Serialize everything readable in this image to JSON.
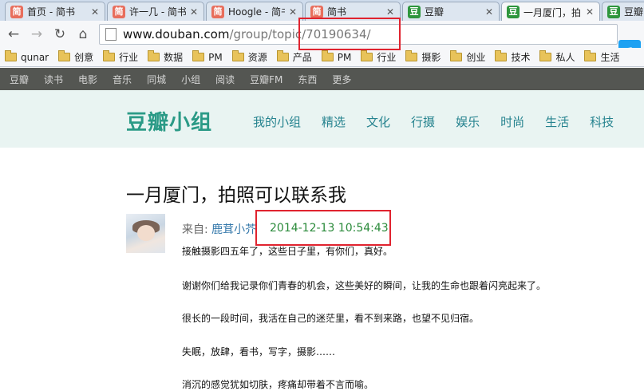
{
  "tabs": [
    {
      "icon": "jianshu-icon",
      "glyph": "简",
      "title": "首页 - 简书"
    },
    {
      "icon": "jianshu-icon",
      "glyph": "简",
      "title": "许一几 - 简书"
    },
    {
      "icon": "jianshu-icon",
      "glyph": "简",
      "title": "Hoogle - 简书"
    },
    {
      "icon": "jianshu-icon",
      "glyph": "简",
      "title": "简书"
    },
    {
      "icon": "douban-icon",
      "glyph": "豆",
      "title": "豆瓣"
    },
    {
      "icon": "douban-icon",
      "glyph": "豆",
      "title": "一月厦门，拍"
    },
    {
      "icon": "douban-icon",
      "glyph": "豆",
      "title": "豆瓣"
    }
  ],
  "toolbar": {
    "url_host": "www.douban.com",
    "url_path": "/group/topic/70190634/"
  },
  "bookmarks": [
    "qunar",
    "创意",
    "行业",
    "数据",
    "PM",
    "资源",
    "产品",
    "PM",
    "行业",
    "摄影",
    "创业",
    "技术",
    "私人",
    "生活"
  ],
  "global_nav": [
    "豆瓣",
    "读书",
    "电影",
    "音乐",
    "同城",
    "小组",
    "阅读",
    "豆瓣FM",
    "东西",
    "更多"
  ],
  "group_header": {
    "logo": "豆瓣小组",
    "menu": [
      "我的小组",
      "精选",
      "文化",
      "行摄",
      "娱乐",
      "时尚",
      "生活",
      "科技"
    ]
  },
  "topic": {
    "title": "一月厦门，拍照可以联系我",
    "from_label": "来自: ",
    "author": "鹿茸小芥",
    "timestamp": "2014-12-13 10:54:43",
    "paragraphs": [
      "接触摄影四五年了，这些日子里，有你们，真好。",
      "谢谢你们给我记录你们青春的机会，这些美好的瞬间，让我的生命也跟着闪亮起来了。",
      "很长的一段时间，我活在自己的迷茫里，看不到来路，也望不见归宿。",
      "失眠，放肆，看书，写字，摄影……",
      "消沉的感觉犹如切肤，疼痛却带着不言而喻。"
    ]
  },
  "colors": {
    "douban_green": "#2e963d",
    "jianshu_red": "#e86e5c",
    "highlight_red": "#e0232f",
    "timestamp_green": "#2a8a3a"
  }
}
